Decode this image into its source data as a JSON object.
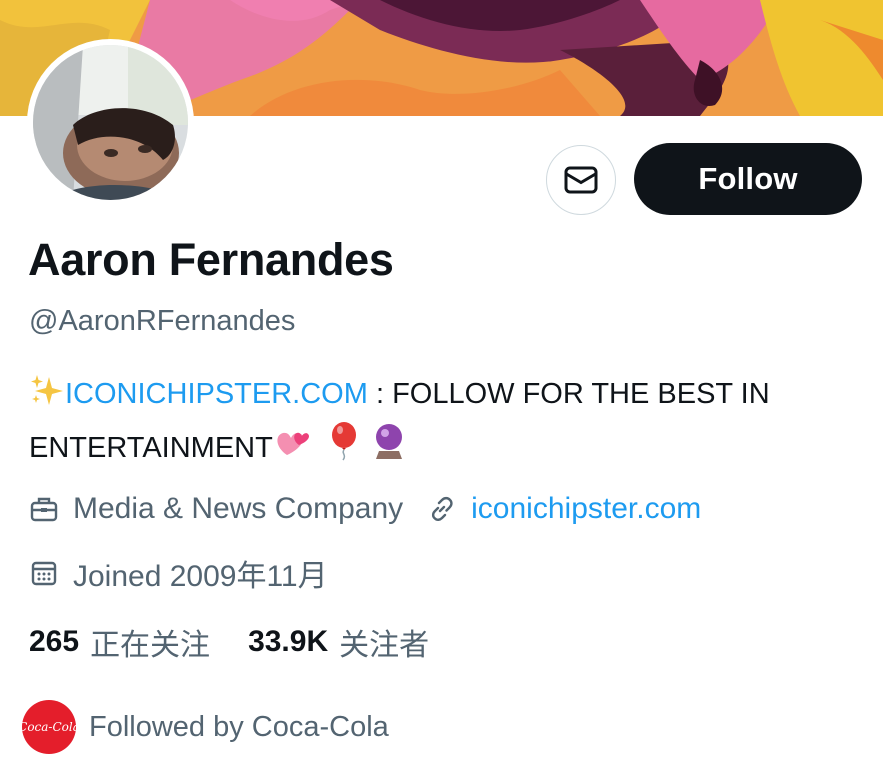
{
  "profile": {
    "name": "Aaron Fernandes",
    "handle": "@AaronRFernandes"
  },
  "actions": {
    "follow_label": "Follow"
  },
  "bio": {
    "link_text": "ICONICHIPSTER.COM",
    "text_line1": " : FOLLOW FOR THE BEST IN",
    "text_line2": "ENTERTAINMENT",
    "emojis": [
      "sparkles",
      "two-hearts",
      "balloon",
      "crystal-ball"
    ]
  },
  "meta": {
    "category": "Media & News Company",
    "website": "iconichipster.com",
    "joined": "Joined 2009年11月"
  },
  "stats": {
    "following_count": "265",
    "following_label": "正在关注",
    "followers_count": "33.9K",
    "followers_label": "关注者"
  },
  "followed_by": {
    "avatar_text": "Coca-Cola",
    "text": "Followed by Coca-Cola"
  },
  "colors": {
    "accent": "#1d9bf0",
    "primary_text": "#0f1419",
    "secondary_text": "#536471",
    "button_bg": "#0f1419"
  }
}
